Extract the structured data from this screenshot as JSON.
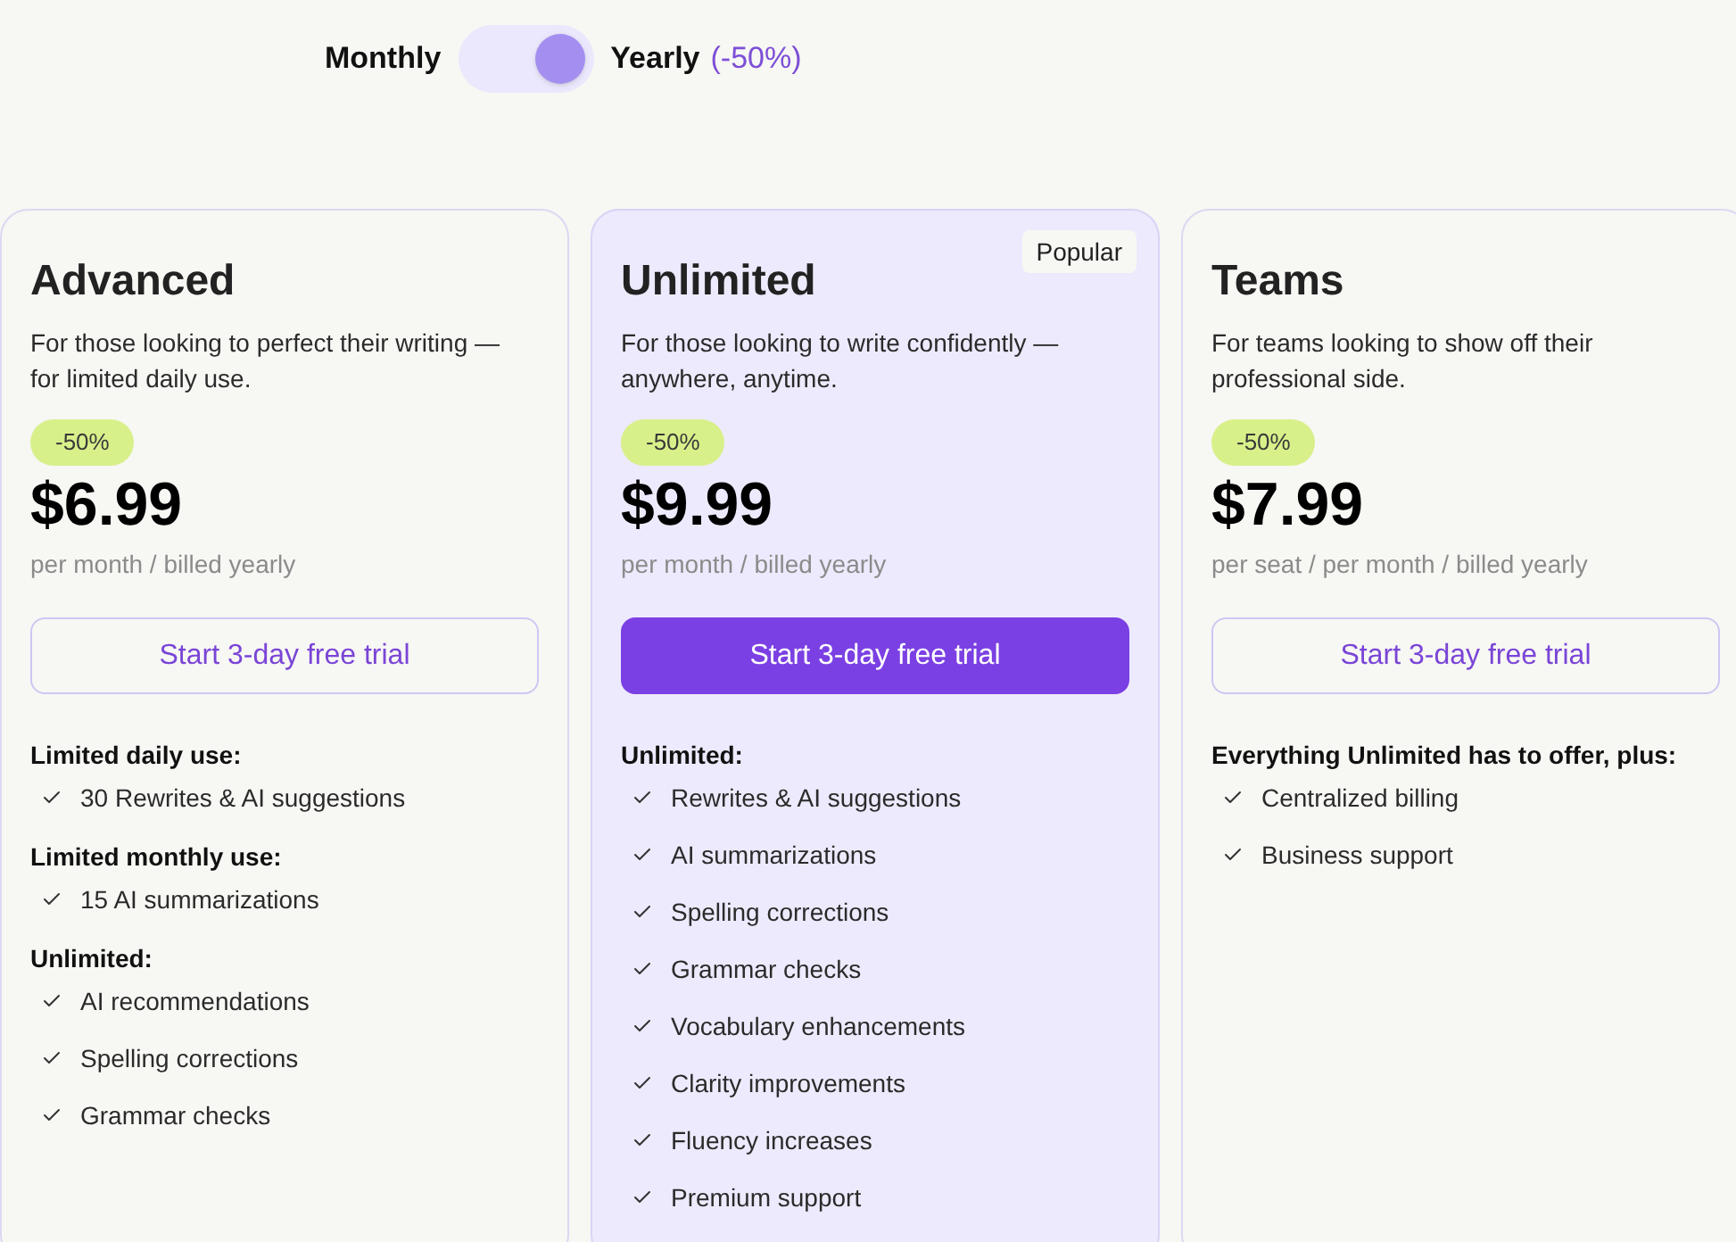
{
  "billing_toggle": {
    "monthly_label": "Monthly",
    "yearly_label": "Yearly",
    "yearly_discount": "(-50%)",
    "on": true
  },
  "plans": [
    {
      "name": "Advanced",
      "featured": false,
      "description": "For those looking to perfect their writing — for limited daily use.",
      "discount": "-50%",
      "price": "$6.99",
      "billing": "per month / billed yearly",
      "button": "Start 3-day free trial",
      "feature_groups": [
        {
          "heading": "Limited daily use:",
          "items": [
            "30 Rewrites & AI suggestions"
          ]
        },
        {
          "heading": "Limited monthly use:",
          "items": [
            "15 AI summarizations"
          ]
        },
        {
          "heading": "Unlimited:",
          "items": [
            "AI recommendations",
            "Spelling corrections",
            "Grammar checks"
          ]
        }
      ]
    },
    {
      "name": "Unlimited",
      "featured": true,
      "badge": "Popular",
      "description": "For those looking to write confidently — anywhere, anytime.",
      "discount": "-50%",
      "price": "$9.99",
      "billing": "per month / billed yearly",
      "button": "Start 3-day free trial",
      "feature_groups": [
        {
          "heading": "Unlimited:",
          "items": [
            "Rewrites & AI suggestions",
            "AI summarizations",
            "Spelling corrections",
            "Grammar checks",
            "Vocabulary enhancements",
            "Clarity improvements",
            "Fluency increases",
            "Premium support"
          ]
        }
      ]
    },
    {
      "name": "Teams",
      "featured": false,
      "description": "For teams looking to show off their professional side.",
      "discount": "-50%",
      "price": "$7.99",
      "billing": "per seat / per month / billed yearly",
      "button": "Start 3-day free trial",
      "feature_groups": [
        {
          "heading": "Everything Unlimited has to offer, plus:",
          "items": [
            "Centralized billing",
            "Business support"
          ]
        }
      ]
    }
  ]
}
